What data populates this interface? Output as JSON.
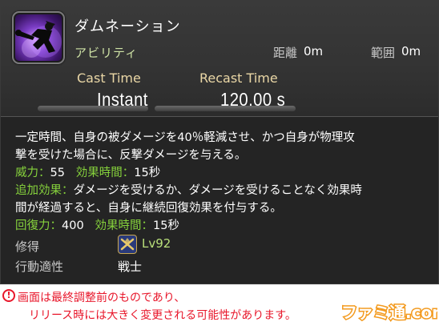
{
  "skill": {
    "name": "ダムネーション",
    "type": "アビリティ",
    "icon": "damnation-icon"
  },
  "range": {
    "label": "距離",
    "value": "0m"
  },
  "radius": {
    "label": "範囲",
    "value": "0m"
  },
  "cast": {
    "label": "Cast Time",
    "value": "Instant"
  },
  "recast": {
    "label": "Recast Time",
    "value": "120.00 s"
  },
  "description": {
    "line1": "一定時間、自身の被ダメージを40％軽減させ、かつ自身が物理攻",
    "line2": "撃を受けた場合に、反撃ダメージを与える。",
    "potency_label": "威力：",
    "potency_value": "55",
    "duration_label": "効果時間：",
    "duration_value": "15秒",
    "additional_label": "追加効果：",
    "additional_text1": "ダメージを受けるか、ダメージを受けることなく効果時",
    "additional_text2": "間が経過すると、自身に継続回復効果を付与する。",
    "heal_label": "回復力：",
    "heal_value": "400",
    "heal_duration_label": "効果時間：",
    "heal_duration_value": "15秒"
  },
  "learned": {
    "label": "修得",
    "level": "Lv92"
  },
  "class": {
    "label": "行動適性",
    "value": "戦士"
  },
  "notice": {
    "icon": "!",
    "line1": "画面は最終調整前のものであり、",
    "line2": "リリース時には大きく変更される可能性があります。"
  },
  "watermark": {
    "text": "ファミ通.com"
  },
  "colors": {
    "background": "#242424",
    "effect_green": "#86d23c",
    "time_label": "#ead7a6",
    "type_text": "#cfe3a6",
    "notice_red": "#e8162a",
    "watermark_orange": "#f39a1e"
  }
}
